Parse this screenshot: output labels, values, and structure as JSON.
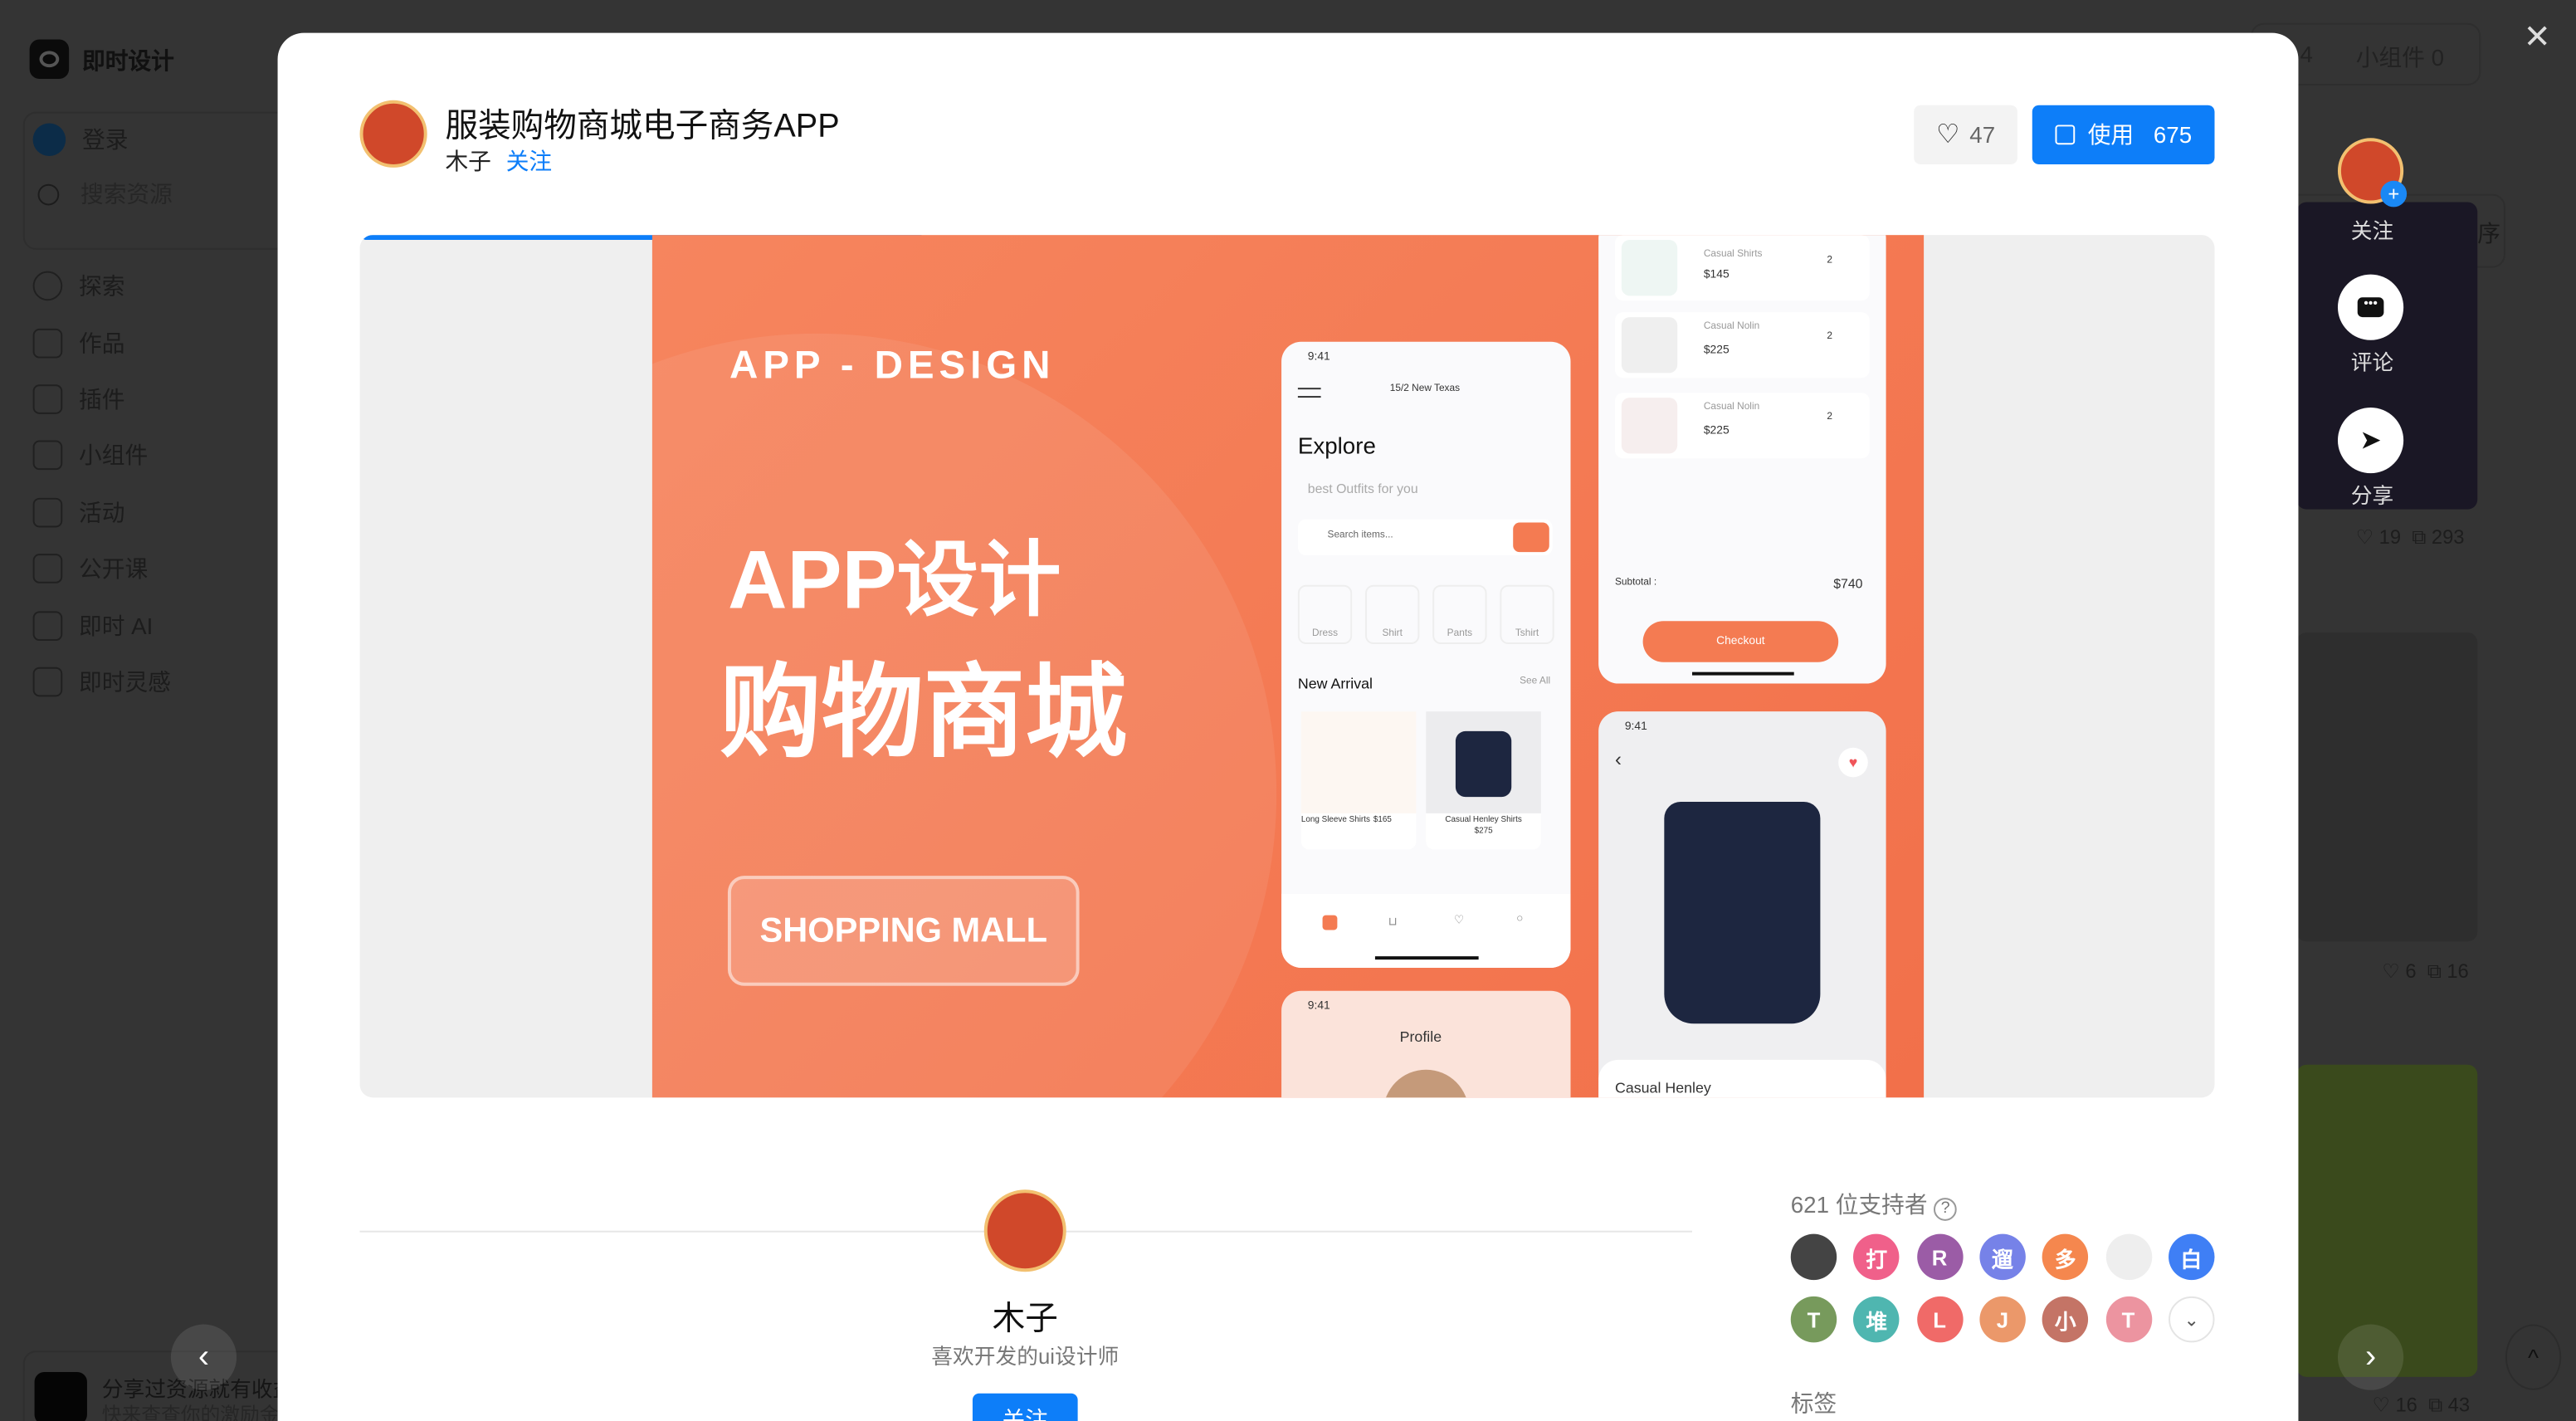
{
  "app": {
    "name": "即时设计",
    "logo_icon": "logo-icon"
  },
  "sidebar": {
    "login": "登录",
    "search_placeholder": "搜索资源",
    "items": [
      {
        "label": "探索",
        "icon": "planet-icon"
      },
      {
        "label": "作品",
        "icon": "file-icon"
      },
      {
        "label": "插件",
        "icon": "puzzle-icon"
      },
      {
        "label": "小组件",
        "icon": "widget-icon"
      },
      {
        "label": "活动",
        "icon": "trophy-icon"
      },
      {
        "label": "公开课",
        "icon": "book-icon"
      },
      {
        "label": "即时 AI",
        "icon": "magic-wand-icon"
      },
      {
        "label": "即时灵感",
        "icon": "sparkles-icon"
      }
    ],
    "promo": {
      "title": "分享过资源就有收益",
      "subtitle": "快来查查你的激励金"
    }
  },
  "background": {
    "tab_count": "4",
    "tab_widget": "小组件 0",
    "sort": "综合排序",
    "cards": [
      {
        "likes": "19",
        "copies": "293"
      },
      {
        "likes": "6",
        "copies": "16"
      },
      {
        "likes": "16",
        "copies": "43"
      }
    ]
  },
  "modal": {
    "title": "服装购物商城电子商务APP",
    "author": "木子",
    "follow": "关注",
    "likes": "47",
    "use_label": "使用",
    "use_count": "675",
    "progress": 0.3,
    "preview": {
      "design_label": "APP - DESIGN",
      "headline1": "APP设计",
      "headline2": "购物商城",
      "cta": "SHOPPING MALL",
      "explore": {
        "time": "9:41",
        "location": "15/2 New Texas",
        "title": "Explore",
        "subtitle": "best Outfits for you",
        "search": "Search items...",
        "categories": [
          "Dress",
          "Shirt",
          "Pants",
          "Tshirt"
        ],
        "section": "New Arrival",
        "see_all": "See All",
        "products": [
          {
            "name": "Long Sleeve Shirts",
            "price": "$165"
          },
          {
            "name": "Casual Henley Shirts",
            "price": "$275"
          }
        ]
      },
      "cart": {
        "items": [
          {
            "name": "Casual Shirts",
            "price": "$145",
            "qty": "2"
          },
          {
            "name": "Casual Nolin",
            "price": "$225",
            "qty": "2"
          },
          {
            "name": "Casual Nolin",
            "price": "$225",
            "qty": "2"
          }
        ],
        "subtotal_label": "Subtotal  :",
        "subtotal": "$740",
        "checkout": "Checkout"
      },
      "detail": {
        "time": "9:41",
        "name": "Casual Henley"
      },
      "profile": {
        "time": "9:41",
        "title": "Profile"
      }
    },
    "author_card": {
      "name": "木子",
      "bio": "喜欢开发的ui设计师",
      "follow": "关注"
    },
    "supporters": {
      "label": "621 位支持者",
      "avatars": [
        {
          "t": "",
          "c": "#444"
        },
        {
          "t": "打",
          "c": "#f0608a"
        },
        {
          "t": "R",
          "c": "#9b5ca6"
        },
        {
          "t": "遛",
          "c": "#7682e8"
        },
        {
          "t": "多",
          "c": "#f5874e"
        },
        {
          "t": "",
          "c": "#eeeeee"
        },
        {
          "t": "白",
          "c": "#3f7ff5"
        },
        {
          "t": "T",
          "c": "#779a5c"
        },
        {
          "t": "堆",
          "c": "#4fb6b0"
        },
        {
          "t": "L",
          "c": "#f06a68"
        },
        {
          "t": "J",
          "c": "#eb986a"
        },
        {
          "t": "小",
          "c": "#c47466"
        },
        {
          "t": "T",
          "c": "#ec94a0"
        }
      ]
    },
    "tags_label": "标签"
  },
  "actions": {
    "follow": "关注",
    "comment": "评论",
    "share": "分享"
  },
  "colors": {
    "accent": "#0d7ef9",
    "orange": "#f47b52"
  }
}
